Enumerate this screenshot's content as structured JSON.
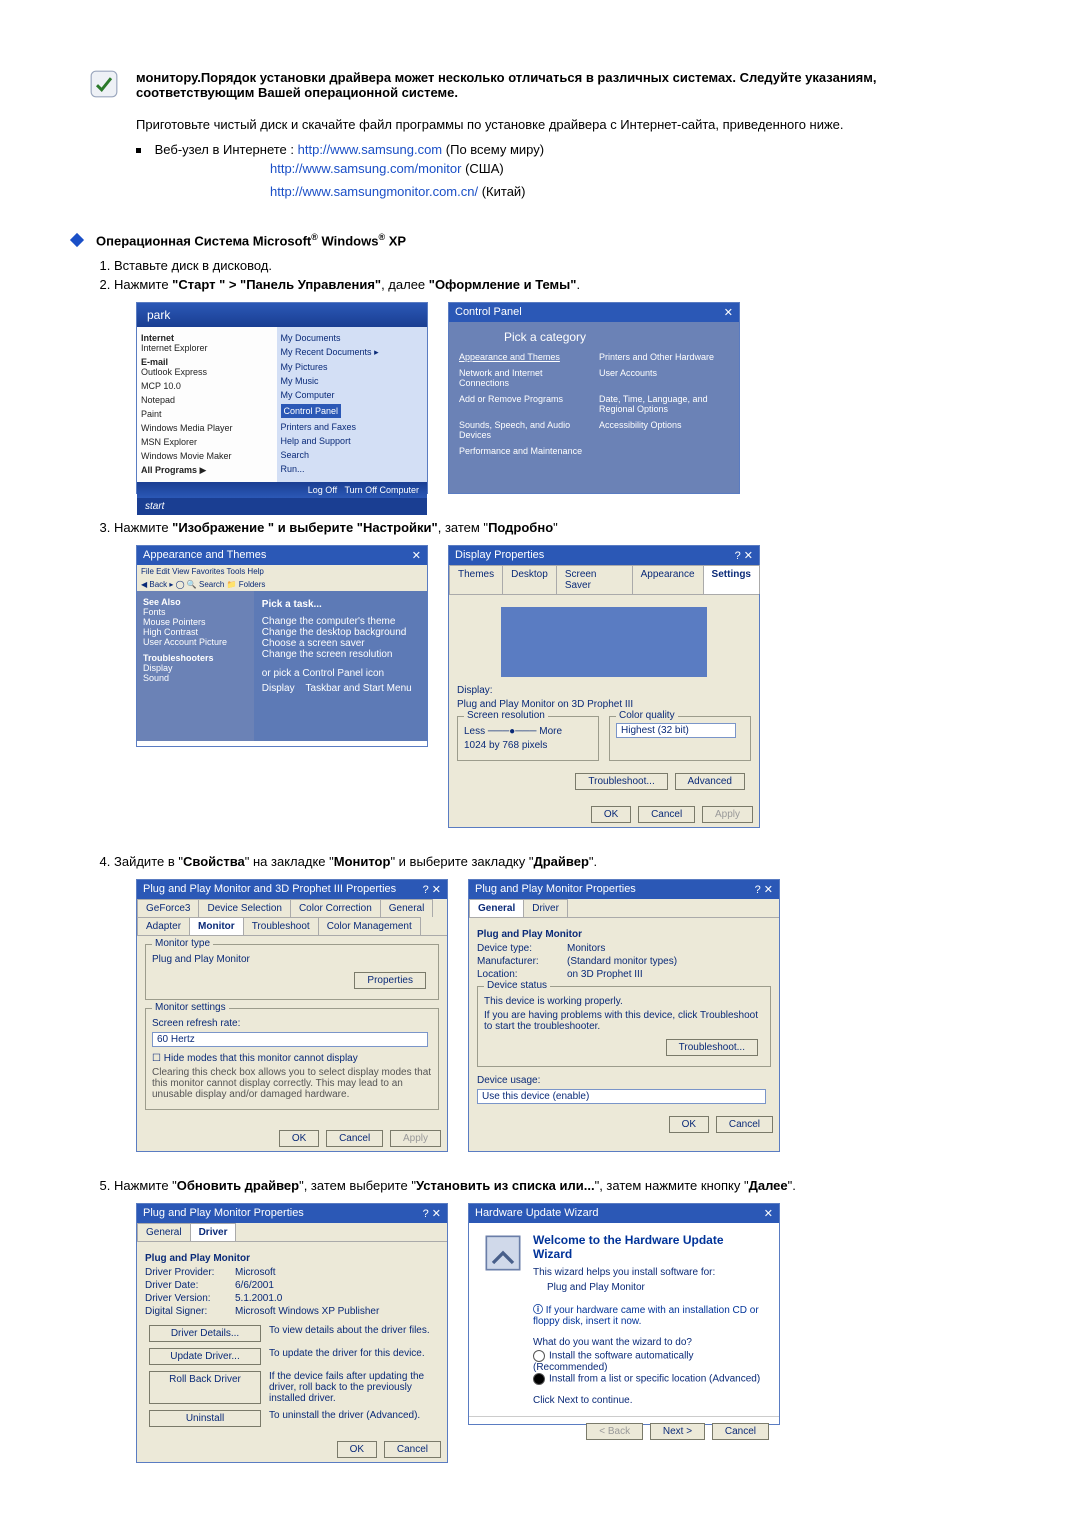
{
  "header": {
    "line1": "монитору.Порядок установки драйвера может несколько отличаться в различных системах. Следуйте указаниям, соответствующим Вашей операционной системе."
  },
  "intro": "Приготовьте чистый диск и скачайте файл программы по установке драйвера с Интернет-сайта, приведенного ниже.",
  "web": {
    "label": "Веб-узел в Интернете :",
    "l1_url": "http://www.samsung.com",
    "l1_note": " (По всему миру)",
    "l2_url": "http://www.samsung.com/monitor",
    "l2_note": " (США)",
    "l3_url": "http://www.samsungmonitor.com.cn/",
    "l3_note": " (Китай)"
  },
  "section": {
    "title_pre": "Операционная Система Microsoft",
    "title_mid": " Windows",
    "title_post": " XP"
  },
  "steps": {
    "s1": "Вставьте диск в дисковод.",
    "s2_a": "Нажмите ",
    "s2_b": "\"Старт \" > \"Панель Управления\"",
    "s2_c": ", далее ",
    "s2_d": "\"Оформление и Темы\"",
    "s2_e": ".",
    "s3_a": "Нажмите ",
    "s3_b": "\"Изображение \" и выберите \"Настройки\"",
    "s3_c": ", затем \"",
    "s3_d": "Подробно",
    "s3_e": "\"",
    "s4_a": "Зайдите в \"",
    "s4_b": "Свойства",
    "s4_c": "\" на закладке \"",
    "s4_d": "Монитор",
    "s4_e": "\" и выберите закладку \"",
    "s4_f": "Драйвер",
    "s4_g": "\".",
    "s5_a": "Нажмите \"",
    "s5_b": "Обновить драйвер",
    "s5_c": "\", затем выберите \"",
    "s5_d": "Установить из списка или...",
    "s5_e": "\", затем нажмите кнопку \"",
    "s5_f": "Далее",
    "s5_g": "\"."
  },
  "startmenu": {
    "user": "park",
    "left": {
      "i1": "Internet",
      "i1s": "Internet Explorer",
      "i2": "E-mail",
      "i2s": "Outlook Express",
      "i3": "MCP 10.0",
      "i4": "Notepad",
      "i5": "Paint",
      "i6": "Windows Media Player",
      "i7": "MSN Explorer",
      "i8": "Windows Movie Maker",
      "all": "All Programs"
    },
    "right": {
      "r1": "My Documents",
      "r2": "My Recent Documents",
      "r3": "My Pictures",
      "r4": "My Music",
      "r5": "My Computer",
      "r6": "Control Panel",
      "r7": "Printers and Faxes",
      "r8": "Help and Support",
      "r9": "Search",
      "r10": "Run..."
    },
    "footer": {
      "logoff": "Log Off",
      "turnoff": "Turn Off Computer"
    },
    "start": "start"
  },
  "controlpanel": {
    "title": "Control Panel",
    "pick": "Pick a category",
    "items": {
      "a": "Appearance and Themes",
      "b": "Printers and Other Hardware",
      "c": "Network and Internet Connections",
      "d": "User Accounts",
      "e": "Add or Remove Programs",
      "f": "Date, Time, Language, and Regional Options",
      "g": "Sounds, Speech, and Audio Devices",
      "h": "Accessibility Options",
      "i": "Performance and Maintenance"
    }
  },
  "appearance": {
    "title": "Appearance and Themes",
    "pick": "Pick a task...",
    "t1": "Change the computer's theme",
    "t2": "Change the desktop background",
    "t3": "Choose a screen saver",
    "t4": "Change the screen resolution",
    "or": "or pick a Control Panel icon",
    "ic1": "Display",
    "ic2": "Taskbar and Start Menu"
  },
  "displayprops": {
    "title": "Display Properties",
    "tabs": {
      "t1": "Themes",
      "t2": "Desktop",
      "t3": "Screen Saver",
      "t4": "Appearance",
      "t5": "Settings"
    },
    "display_label": "Display:",
    "display_val": "Plug and Play Monitor on 3D Prophet III",
    "res_label": "Screen resolution",
    "qual_label": "Color quality",
    "less": "Less",
    "more": "More",
    "res_val": "1024 by 768 pixels",
    "qual_val": "Highest (32 bit)",
    "btn_trouble": "Troubleshoot...",
    "btn_adv": "Advanced",
    "ok": "OK",
    "cancel": "Cancel",
    "apply": "Apply"
  },
  "pnp3d": {
    "title": "Plug and Play Monitor and 3D Prophet III Properties",
    "tabs": {
      "a": "GeForce3",
      "b": "Device Selection",
      "c": "Color Correction",
      "d": "General",
      "e": "Adapter",
      "f": "Monitor",
      "g": "Troubleshoot",
      "h": "Color Management"
    },
    "mtype": "Monitor type",
    "mtype_v": "Plug and Play Monitor",
    "btn_props": "Properties",
    "mset": "Monitor settings",
    "refresh": "Screen refresh rate:",
    "refresh_v": "60 Hertz",
    "hide": "Hide modes that this monitor cannot display",
    "hide_note": "Clearing this check box allows you to select display modes that this monitor cannot display correctly. This may lead to an unusable display and/or damaged hardware.",
    "ok": "OK",
    "cancel": "Cancel",
    "apply": "Apply"
  },
  "pnp": {
    "title": "Plug and Play Monitor Properties",
    "tabs": {
      "g": "General",
      "d": "Driver"
    },
    "name": "Plug and Play Monitor",
    "kv": {
      "dt_l": "Device type:",
      "dt_v": "Monitors",
      "mf_l": "Manufacturer:",
      "mf_v": "(Standard monitor types)",
      "lo_l": "Location:",
      "lo_v": "on 3D Prophet III"
    },
    "ds_label": "Device status",
    "ds_text": "This device is working properly.",
    "ds_help": "If you are having problems with this device, click Troubleshoot to start the troubleshooter.",
    "btn_trouble": "Troubleshoot...",
    "du_label": "Device usage:",
    "du_val": "Use this device (enable)",
    "ok": "OK",
    "cancel": "Cancel"
  },
  "pnpdriver": {
    "title": "Plug and Play Monitor Properties",
    "tabs": {
      "g": "General",
      "d": "Driver"
    },
    "name": "Plug and Play Monitor",
    "kv": {
      "dp_l": "Driver Provider:",
      "dp_v": "Microsoft",
      "dd_l": "Driver Date:",
      "dd_v": "6/6/2001",
      "dv_l": "Driver Version:",
      "dv_v": "5.1.2001.0",
      "ds_l": "Digital Signer:",
      "ds_v": "Microsoft Windows XP Publisher"
    },
    "btns": {
      "b1": "Driver Details...",
      "b1d": "To view details about the driver files.",
      "b2": "Update Driver...",
      "b2d": "To update the driver for this device.",
      "b3": "Roll Back Driver",
      "b3d": "If the device fails after updating the driver, roll back to the previously installed driver.",
      "b4": "Uninstall",
      "b4d": "To uninstall the driver (Advanced)."
    },
    "ok": "OK",
    "cancel": "Cancel"
  },
  "wizard": {
    "title": "Hardware Update Wizard",
    "welcome": "Welcome to the Hardware Update Wizard",
    "helps": "This wizard helps you install software for:",
    "dev": "Plug and Play Monitor",
    "cd": "If your hardware came with an installation CD or floppy disk, insert it now.",
    "q": "What do you want the wizard to do?",
    "opt1": "Install the software automatically (Recommended)",
    "opt2": "Install from a list or specific location (Advanced)",
    "cont": "Click Next to continue.",
    "back": "< Back",
    "next": "Next >",
    "cancel": "Cancel"
  }
}
